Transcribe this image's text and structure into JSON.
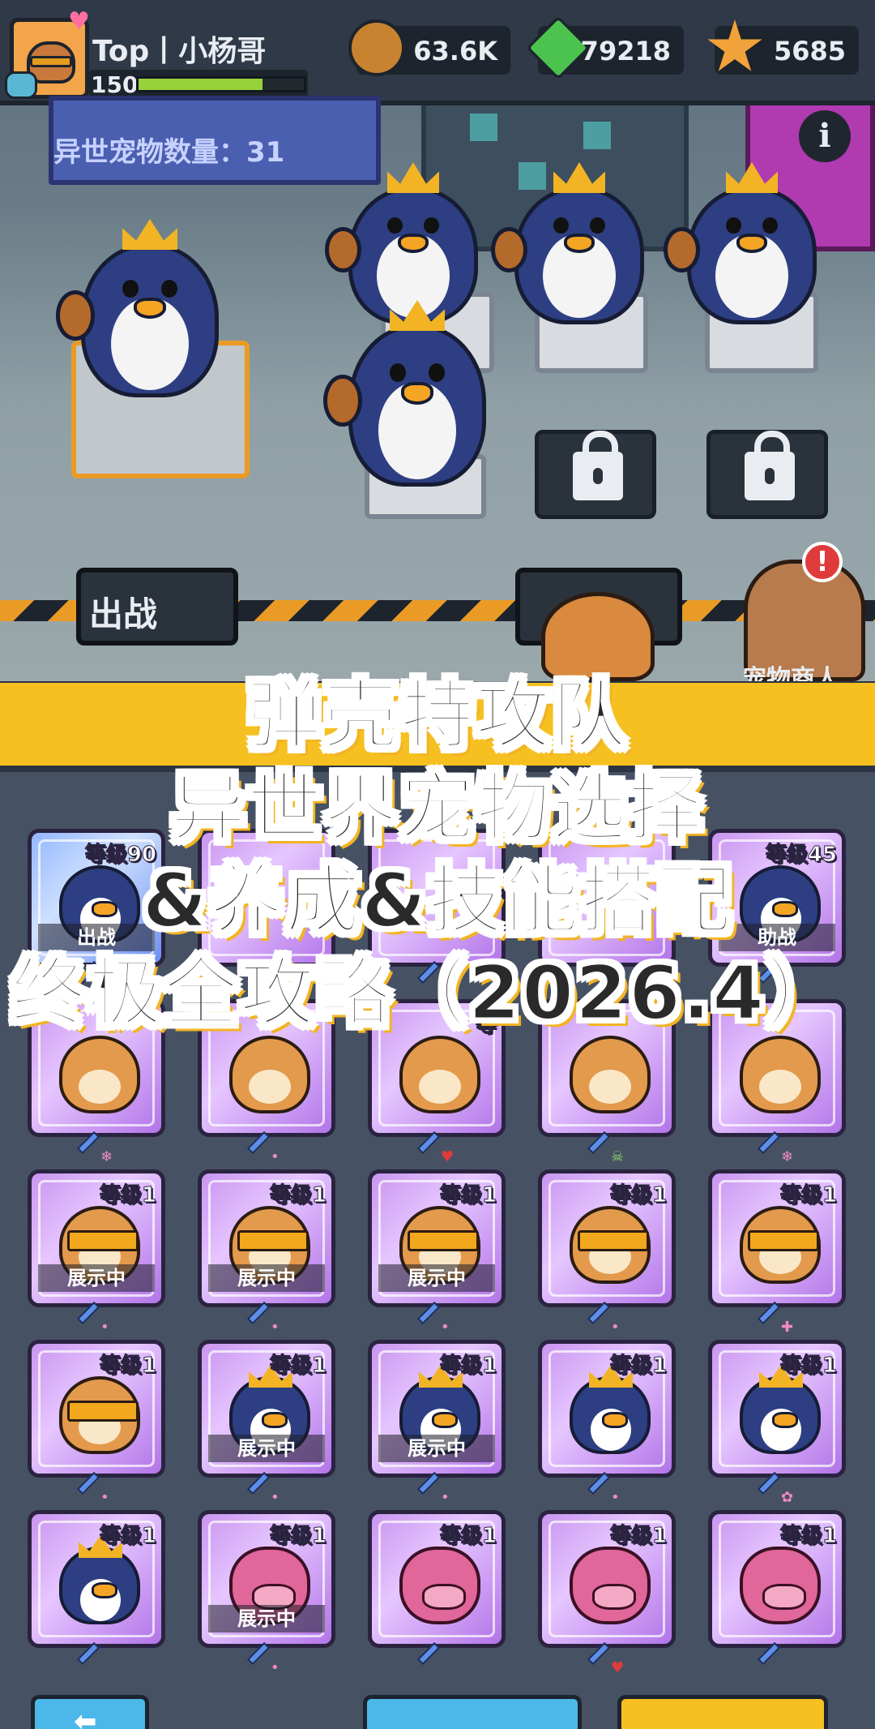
{
  "header": {
    "player_name": "Top丨小杨哥",
    "player_level": "150",
    "xp_fraction": 0.75,
    "resources": [
      {
        "icon": "coin-icon",
        "value": "63.6K"
      },
      {
        "icon": "gem-icon",
        "value": "79218"
      },
      {
        "icon": "star-icon",
        "value": "5685"
      }
    ]
  },
  "scene": {
    "pet_count": "异世宠物数量：31",
    "info_icon": "i",
    "deploy_label": "出战",
    "merchant_alert": "!",
    "merchant_label": "宠物商人"
  },
  "title": {
    "line1": "弹壳特攻队",
    "line2": "异世界宠物选择",
    "line3": "&养成&技能搭配",
    "line4": "终极全攻略（2026.4）"
  },
  "cards": [
    {
      "level": "等级90",
      "tag": "出战",
      "pet": "penguin",
      "style": "blue"
    },
    {
      "level": "",
      "tag": "",
      "pet": "",
      "style": "purple"
    },
    {
      "level": "",
      "tag": "",
      "pet": "",
      "style": "purple"
    },
    {
      "level": "",
      "tag": "",
      "pet": "",
      "style": "purple"
    },
    {
      "level": "等级45",
      "tag": "助战",
      "pet": "penguin",
      "style": "purple"
    },
    {
      "level": "",
      "tag": "",
      "pet": "hamster",
      "style": "purple",
      "mark": "❄"
    },
    {
      "level": "",
      "tag": "",
      "pet": "hamster",
      "style": "purple",
      "mark": "•"
    },
    {
      "level": "等",
      "tag": "",
      "pet": "hamster",
      "style": "purple",
      "mark": "♥"
    },
    {
      "level": "",
      "tag": "",
      "pet": "hamster",
      "style": "purple",
      "mark": "☠"
    },
    {
      "level": "",
      "tag": "",
      "pet": "hamster",
      "style": "purple",
      "mark": "❄"
    },
    {
      "level": "等级1",
      "tag": "展示中",
      "pet": "hamster-shades",
      "style": "purple",
      "mark": "•"
    },
    {
      "level": "等级1",
      "tag": "展示中",
      "pet": "hamster-shades",
      "style": "purple",
      "mark": "•"
    },
    {
      "level": "等级1",
      "tag": "展示中",
      "pet": "hamster-shades",
      "style": "purple",
      "mark": "•"
    },
    {
      "level": "等级1",
      "tag": "",
      "pet": "hamster-shades",
      "style": "purple",
      "mark": "•"
    },
    {
      "level": "等级1",
      "tag": "",
      "pet": "hamster-shades",
      "style": "purple",
      "mark": "✚"
    },
    {
      "level": "等级1",
      "tag": "",
      "pet": "hamster-shades",
      "style": "purple",
      "mark": "•"
    },
    {
      "level": "等级1",
      "tag": "展示中",
      "pet": "penguin-crown",
      "style": "purple",
      "mark": "•"
    },
    {
      "level": "等级1",
      "tag": "展示中",
      "pet": "penguin-crown",
      "style": "purple",
      "mark": "•"
    },
    {
      "level": "等级1",
      "tag": "",
      "pet": "penguin-crown",
      "style": "purple",
      "mark": "•"
    },
    {
      "level": "等级1",
      "tag": "",
      "pet": "penguin-crown",
      "style": "purple",
      "mark": "✿"
    },
    {
      "level": "等级1",
      "tag": "",
      "pet": "penguin-crown",
      "style": "purple",
      "mark": ""
    },
    {
      "level": "等级1",
      "tag": "展示中",
      "pet": "puffer",
      "style": "purple",
      "mark": "•"
    },
    {
      "level": "等级1",
      "tag": "",
      "pet": "puffer",
      "style": "purple",
      "mark": ""
    },
    {
      "level": "等级1",
      "tag": "",
      "pet": "puffer",
      "style": "purple",
      "mark": "♥"
    },
    {
      "level": "等级1",
      "tag": "",
      "pet": "puffer",
      "style": "purple",
      "mark": ""
    }
  ],
  "bottom": {
    "back_arrow": "⬅"
  }
}
